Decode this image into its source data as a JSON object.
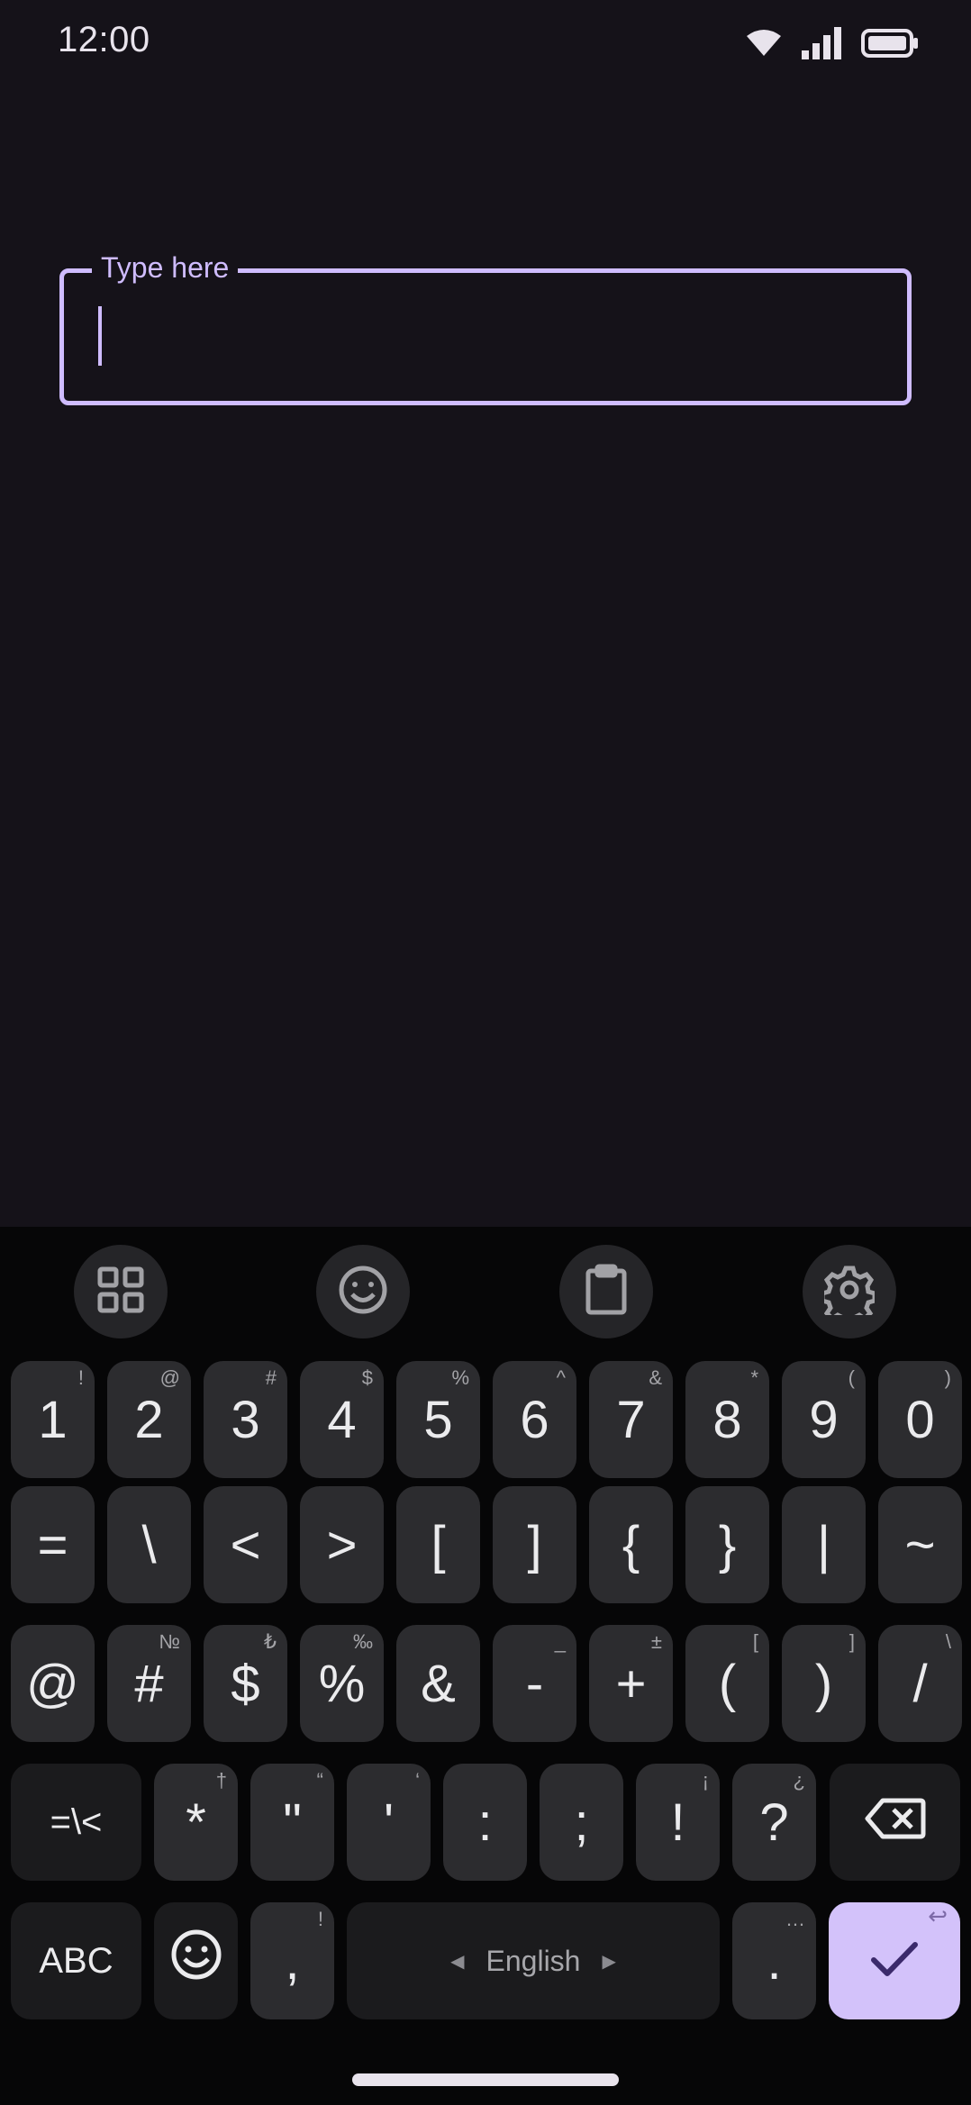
{
  "status_bar": {
    "time": "12:00"
  },
  "text_field": {
    "label": "Type here",
    "value": ""
  },
  "toolbar": {
    "icons": [
      "apps-grid-icon",
      "emoji-icon",
      "clipboard-icon",
      "settings-gear-icon"
    ]
  },
  "keyboard": {
    "row1": [
      {
        "main": "1",
        "hint": "!"
      },
      {
        "main": "2",
        "hint": "@"
      },
      {
        "main": "3",
        "hint": "#"
      },
      {
        "main": "4",
        "hint": "$"
      },
      {
        "main": "5",
        "hint": "%"
      },
      {
        "main": "6",
        "hint": "^"
      },
      {
        "main": "7",
        "hint": "&"
      },
      {
        "main": "8",
        "hint": "*"
      },
      {
        "main": "9",
        "hint": "("
      },
      {
        "main": "0",
        "hint": ")"
      }
    ],
    "row2": [
      {
        "main": "=",
        "hint": ""
      },
      {
        "main": "\\",
        "hint": ""
      },
      {
        "main": "<",
        "hint": ""
      },
      {
        "main": ">",
        "hint": ""
      },
      {
        "main": "[",
        "hint": ""
      },
      {
        "main": "]",
        "hint": ""
      },
      {
        "main": "{",
        "hint": ""
      },
      {
        "main": "}",
        "hint": ""
      },
      {
        "main": "|",
        "hint": ""
      },
      {
        "main": "~",
        "hint": ""
      }
    ],
    "row3": [
      {
        "main": "@",
        "hint": ""
      },
      {
        "main": "#",
        "hint": "№"
      },
      {
        "main": "$",
        "hint": "₺"
      },
      {
        "main": "%",
        "hint": "‰"
      },
      {
        "main": "&",
        "hint": ""
      },
      {
        "main": "-",
        "hint": "_"
      },
      {
        "main": "+",
        "hint": "±"
      },
      {
        "main": "(",
        "hint": "["
      },
      {
        "main": ")",
        "hint": "]"
      },
      {
        "main": "/",
        "hint": "\\"
      }
    ],
    "row4": {
      "more_symbols_label": "=\\<",
      "keys": [
        {
          "main": "*",
          "hint": "†"
        },
        {
          "main": "\"",
          "hint": "“"
        },
        {
          "main": "'",
          "hint": "‘"
        },
        {
          "main": ":",
          "hint": ""
        },
        {
          "main": ";",
          "hint": ""
        },
        {
          "main": "!",
          "hint": "¡"
        },
        {
          "main": "?",
          "hint": "¿"
        }
      ]
    },
    "row5": {
      "abc_label": "ABC",
      "comma": {
        "main": ",",
        "hint": "!"
      },
      "space_label": "English",
      "space_left_arrow": "◀",
      "space_right_arrow": "▶",
      "period": {
        "main": ".",
        "hint": "…"
      },
      "enter_hint": "↩"
    }
  },
  "colors": {
    "accent": "#cfbcff",
    "background": "#151219",
    "keyboard_bg": "#060607",
    "key_bg": "#2c2c2f",
    "enter_bg": "#d3c2fa"
  }
}
